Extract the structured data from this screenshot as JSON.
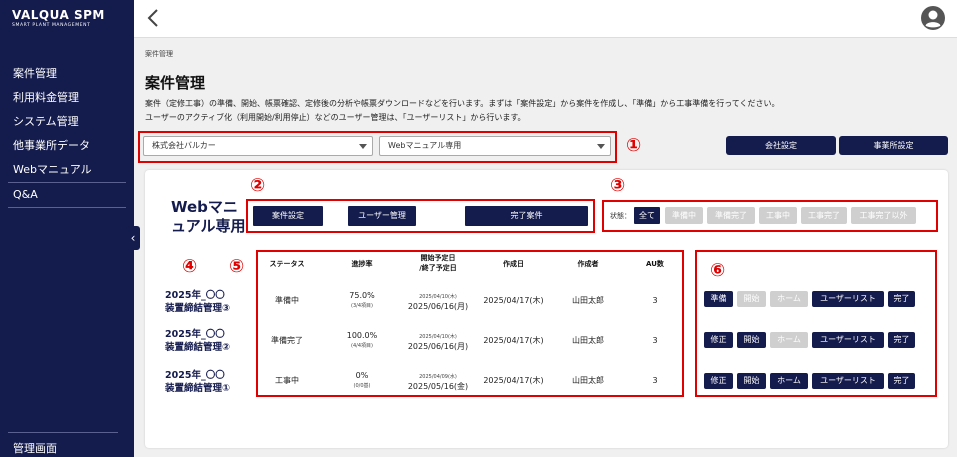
{
  "brand": {
    "title": "VALQUA SPM",
    "subtitle": "SMART PLANT MANAGEMENT"
  },
  "sidebar": {
    "items": [
      {
        "label": "案件管理"
      },
      {
        "label": "利用料金管理"
      },
      {
        "label": "システム管理"
      },
      {
        "label": "他事業所データ"
      },
      {
        "label": "Webマニュアル"
      },
      {
        "label": "Q&A"
      }
    ],
    "bottom_label": "管理画面"
  },
  "topbar": {
    "back_icon": "chevron-left-icon",
    "avatar_icon": "user-avatar-icon"
  },
  "breadcrumb": "案件管理",
  "page_title": "案件管理",
  "description": [
    "案件（定修工事）の準備、開始、帳票確認、定修後の分析や帳票ダウンロードなどを行います。まずは「案件設定」から案件を作成し、「準備」から工事準備を行ってください。",
    "ユーザーのアクティブ化（利用開始/利用停止）などのユーザー管理は、「ユーザーリスト」から行います。"
  ],
  "filters": {
    "company": "株式会社バルカー",
    "office": "Webマニュアル専用"
  },
  "header_buttons": {
    "company_settings": "会社設定",
    "office_settings": "事業所設定"
  },
  "annotations": {
    "n1": "①",
    "n2": "②",
    "n3": "③",
    "n4": "④",
    "n5": "⑤",
    "n6": "⑥"
  },
  "project": {
    "title_line1": "Webマニ",
    "title_line2": "ュアル専用",
    "buttons": {
      "settings": "案件設定",
      "users": "ユーザー管理",
      "completed": "完了案件"
    }
  },
  "status_filter": {
    "label": "状態：",
    "options": [
      "全て",
      "準備中",
      "準備完了",
      "工事中",
      "工事完了",
      "工事完了以外"
    ],
    "selected": "全て"
  },
  "table": {
    "headers": {
      "status": "ステータス",
      "progress": "進捗率",
      "dates_line1": "開始予定日",
      "dates_line2": "/終了予定日",
      "created": "作成日",
      "author": "作成者",
      "au": "AU数"
    },
    "rows": [
      {
        "name_line1": "2025年_〇〇",
        "name_line2": "装置締結管理③",
        "status": "準備中",
        "progress": "75.0%",
        "progress_detail": "(3/4項目)",
        "start": "2025/04/10(木)",
        "end": "2025/06/16(月)",
        "created": "2025/04/17(木)",
        "author": "山田太郎",
        "au": "3",
        "actions": [
          {
            "label": "準備",
            "enabled": true
          },
          {
            "label": "開始",
            "enabled": false
          },
          {
            "label": "ホーム",
            "enabled": false
          },
          {
            "label": "ユーザーリスト",
            "enabled": true
          },
          {
            "label": "完了",
            "enabled": true
          }
        ]
      },
      {
        "name_line1": "2025年_〇〇",
        "name_line2": "装置締結管理②",
        "status": "準備完了",
        "progress": "100.0%",
        "progress_detail": "(4/4項目)",
        "start": "2025/04/10(木)",
        "end": "2025/06/16(月)",
        "created": "2025/04/17(木)",
        "author": "山田太郎",
        "au": "3",
        "actions": [
          {
            "label": "修正",
            "enabled": true
          },
          {
            "label": "開始",
            "enabled": true
          },
          {
            "label": "ホーム",
            "enabled": false
          },
          {
            "label": "ユーザーリスト",
            "enabled": true
          },
          {
            "label": "完了",
            "enabled": true
          }
        ]
      },
      {
        "name_line1": "2025年_〇〇",
        "name_line2": "装置締結管理①",
        "status": "工事中",
        "progress": "0%",
        "progress_detail": "(0/0基)",
        "start": "2025/04/09(水)",
        "end": "2025/05/16(金)",
        "created": "2025/04/17(木)",
        "author": "山田太郎",
        "au": "3",
        "actions": [
          {
            "label": "修正",
            "enabled": true
          },
          {
            "label": "開始",
            "enabled": true
          },
          {
            "label": "ホーム",
            "enabled": true
          },
          {
            "label": "ユーザーリスト",
            "enabled": true
          },
          {
            "label": "完了",
            "enabled": true
          }
        ]
      }
    ]
  },
  "colors": {
    "navy": "#141b4d",
    "annotation_red": "#e00000",
    "disabled": "#cfcfcf"
  }
}
